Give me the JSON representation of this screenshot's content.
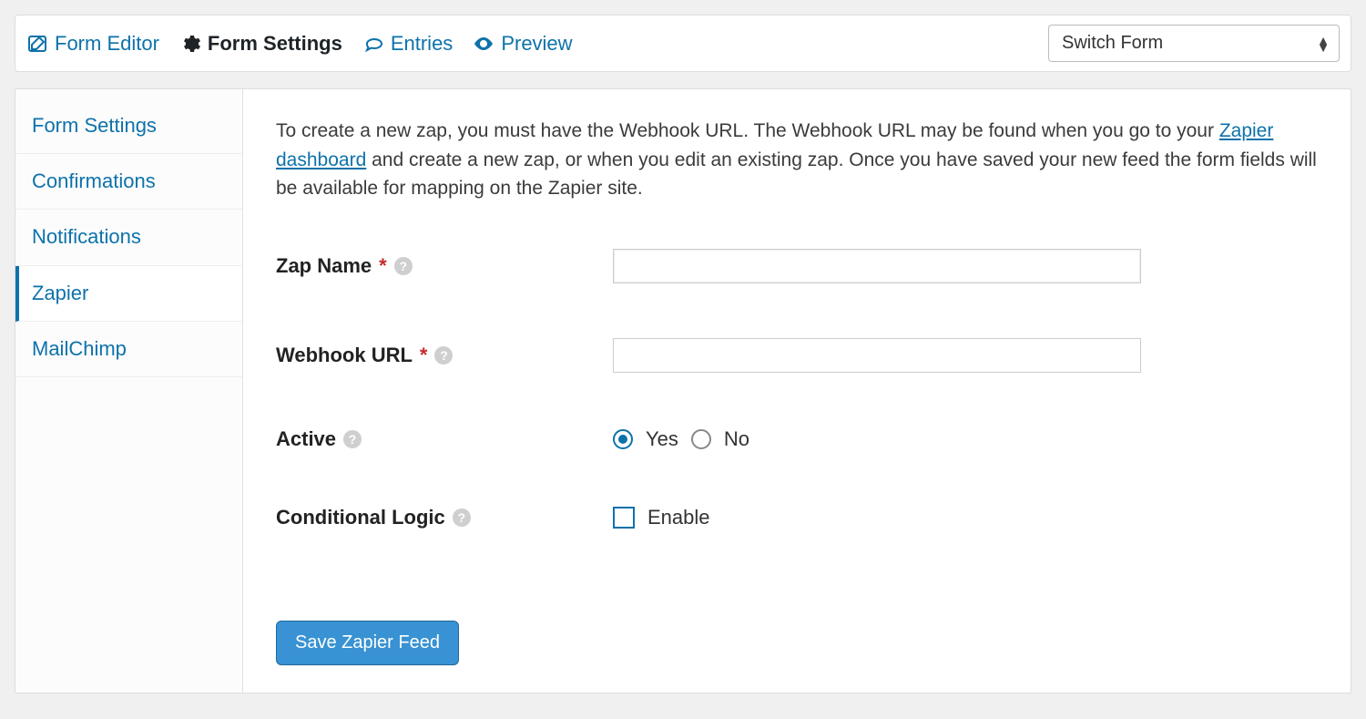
{
  "topnav": {
    "form_editor": "Form Editor",
    "form_settings": "Form Settings",
    "entries": "Entries",
    "preview": "Preview",
    "switch_form_label": "Switch Form"
  },
  "sidebar": {
    "items": [
      {
        "label": "Form Settings"
      },
      {
        "label": "Confirmations"
      },
      {
        "label": "Notifications"
      },
      {
        "label": "Zapier"
      },
      {
        "label": "MailChimp"
      }
    ]
  },
  "intro": {
    "pre": "To create a new zap, you must have the Webhook URL. The Webhook URL may be found when you go to your ",
    "link_text": "Zapier dashboard",
    "post": " and create a new zap, or when you edit an existing zap. Once you have saved your new feed the form fields will be available for mapping on the Zapier site."
  },
  "fields": {
    "zap_name": {
      "label": "Zap Name",
      "required": "*",
      "value": ""
    },
    "webhook_url": {
      "label": "Webhook URL",
      "required": "*",
      "value": ""
    },
    "active": {
      "label": "Active",
      "yes": "Yes",
      "no": "No",
      "selected": "yes"
    },
    "cond_logic": {
      "label": "Conditional Logic",
      "enable": "Enable",
      "checked": false
    }
  },
  "buttons": {
    "save": "Save Zapier Feed"
  },
  "help_char": "?"
}
